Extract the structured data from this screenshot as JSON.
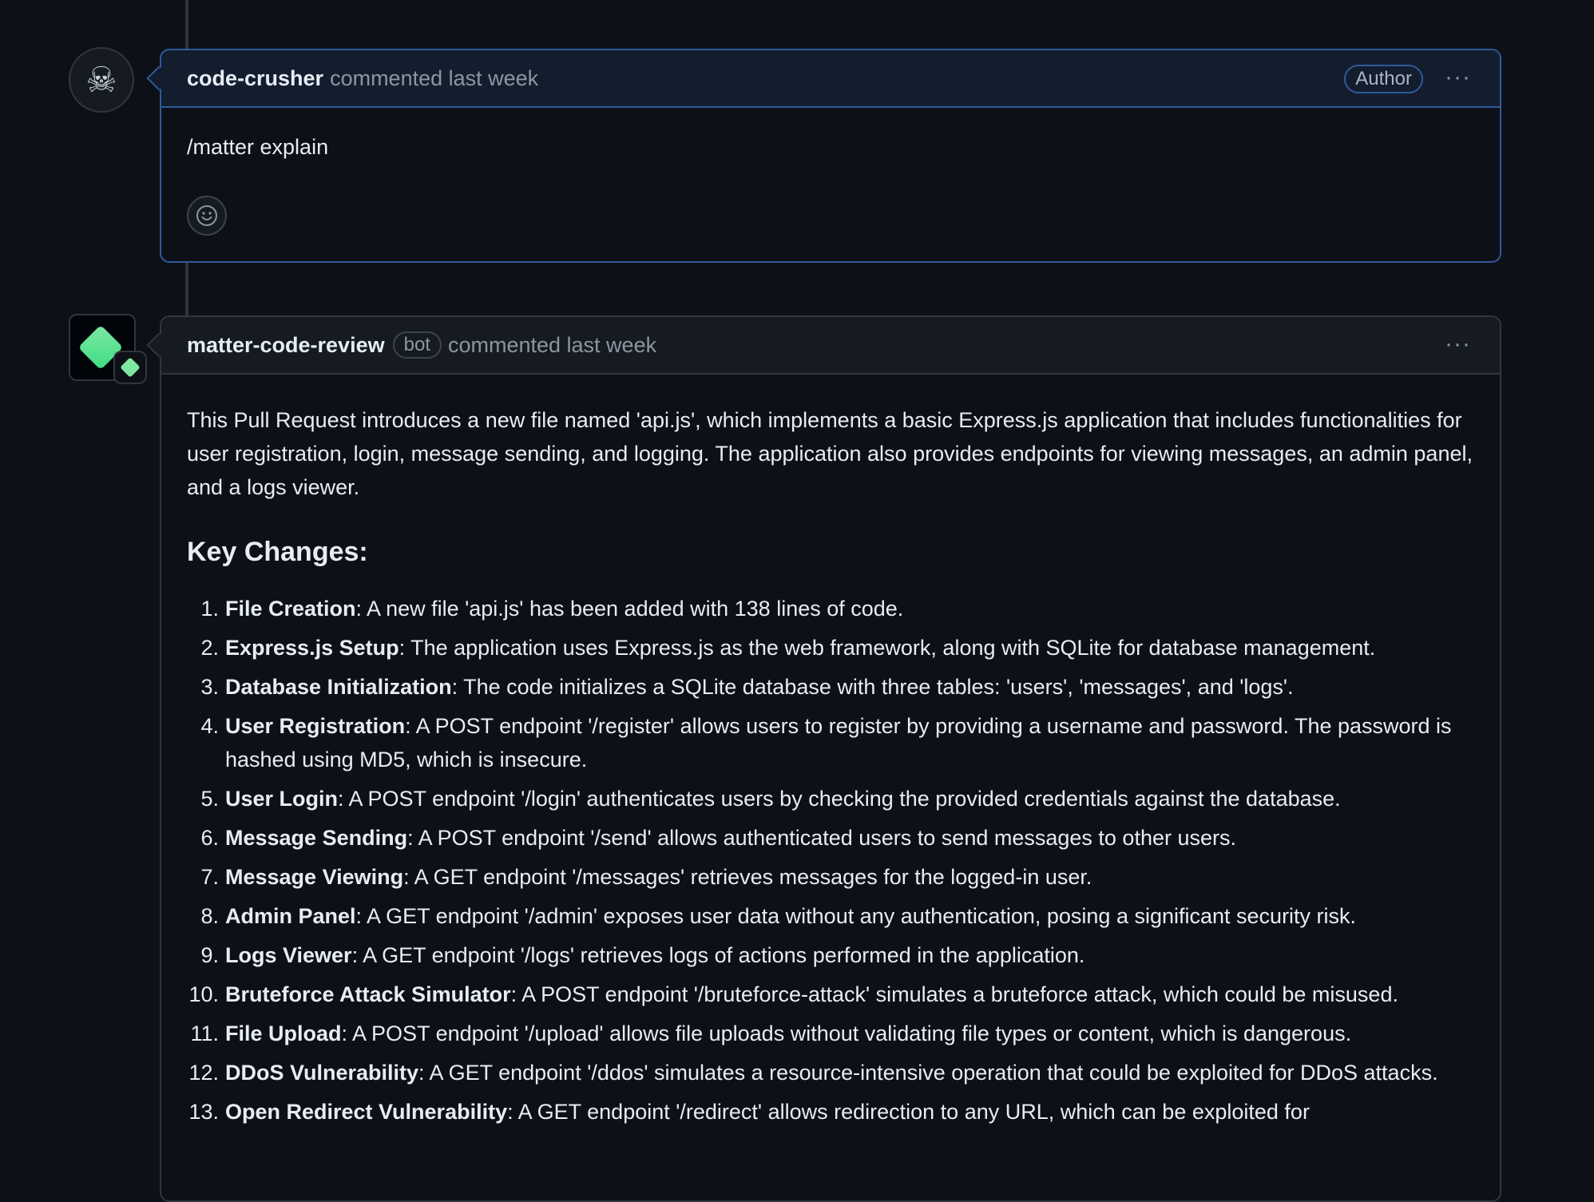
{
  "comment1": {
    "author": "code-crusher",
    "meta": "commented last week",
    "badge": "Author",
    "menu": "···",
    "body": "/matter explain"
  },
  "comment2": {
    "author": "matter-code-review",
    "bot_badge": "bot",
    "meta": "commented last week",
    "menu": "···",
    "intro": "This Pull Request introduces a new file named 'api.js', which implements a basic Express.js application that includes functionalities for user registration, login, message sending, and logging. The application also provides endpoints for viewing messages, an admin panel, and a logs viewer.",
    "heading": "Key Changes:",
    "items": [
      {
        "num": "1.",
        "title": "File Creation",
        "text": ": A new file 'api.js' has been added with 138 lines of code."
      },
      {
        "num": "2.",
        "title": "Express.js Setup",
        "text": ": The application uses Express.js as the web framework, along with SQLite for database management."
      },
      {
        "num": "3.",
        "title": "Database Initialization",
        "text": ": The code initializes a SQLite database with three tables: 'users', 'messages', and 'logs'."
      },
      {
        "num": "4.",
        "title": "User Registration",
        "text": ": A POST endpoint '/register' allows users to register by providing a username and password. The password is hashed using MD5, which is insecure."
      },
      {
        "num": "5.",
        "title": "User Login",
        "text": ": A POST endpoint '/login' authenticates users by checking the provided credentials against the database."
      },
      {
        "num": "6.",
        "title": "Message Sending",
        "text": ": A POST endpoint '/send' allows authenticated users to send messages to other users."
      },
      {
        "num": "7.",
        "title": "Message Viewing",
        "text": ": A GET endpoint '/messages' retrieves messages for the logged-in user."
      },
      {
        "num": "8.",
        "title": "Admin Panel",
        "text": ": A GET endpoint '/admin' exposes user data without any authentication, posing a significant security risk."
      },
      {
        "num": "9.",
        "title": "Logs Viewer",
        "text": ": A GET endpoint '/logs' retrieves logs of actions performed in the application."
      },
      {
        "num": "10.",
        "title": "Bruteforce Attack Simulator",
        "text": ": A POST endpoint '/bruteforce-attack' simulates a bruteforce attack, which could be misused."
      },
      {
        "num": "11.",
        "title": "File Upload",
        "text": ": A POST endpoint '/upload' allows file uploads without validating file types or content, which is dangerous."
      },
      {
        "num": "12.",
        "title": "DDoS Vulnerability",
        "text": ": A GET endpoint '/ddos' simulates a resource-intensive operation that could be exploited for DDoS attacks."
      },
      {
        "num": "13.",
        "title": "Open Redirect Vulnerability",
        "text": ": A GET endpoint '/redirect' allows redirection to any URL, which can be exploited for"
      }
    ]
  },
  "icons": {
    "avatar1": "skull-avatar-icon",
    "avatar2": "diamond-bot-avatar-icon",
    "reaction": "smiley-icon",
    "menu": "kebab-menu-icon"
  }
}
